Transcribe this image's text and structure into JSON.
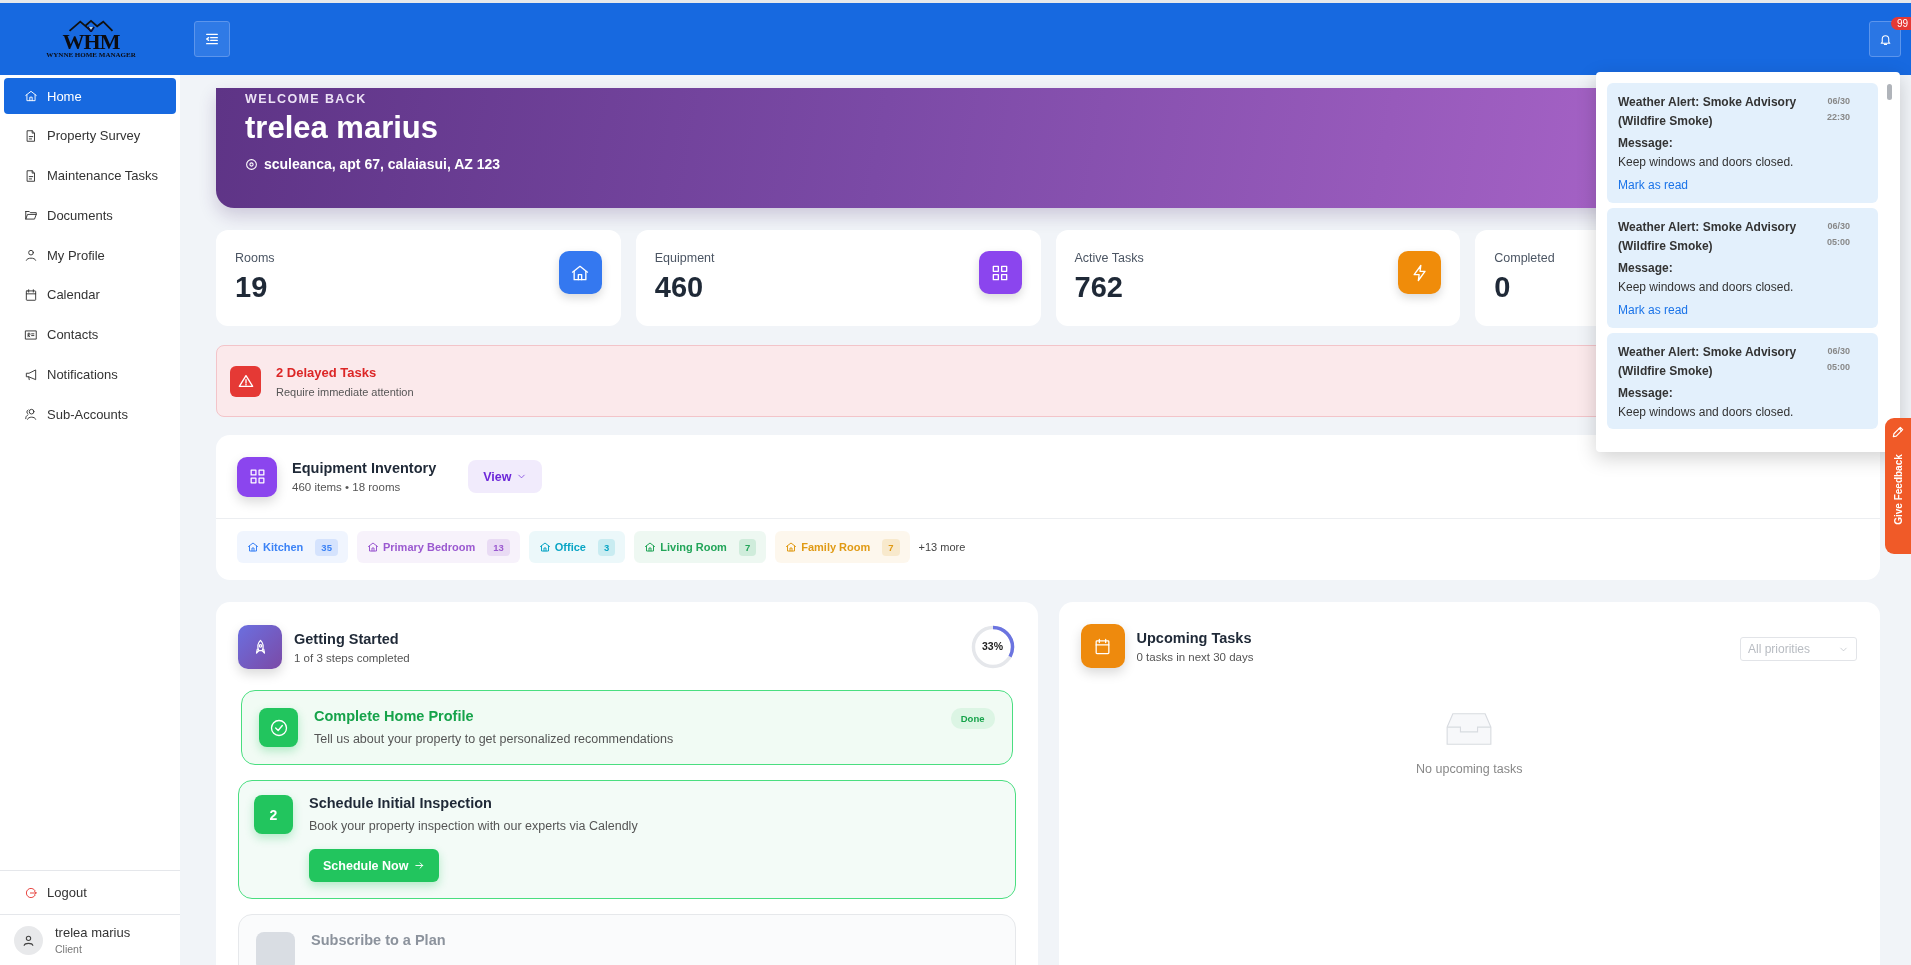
{
  "header": {
    "logo": {
      "mark": "WHM",
      "tagline": "WYNNE HOME MANAGER"
    },
    "notification_badge": "99"
  },
  "sidebar": {
    "items": [
      {
        "label": "Home",
        "selected": true
      },
      {
        "label": "Property Survey",
        "selected": false
      },
      {
        "label": "Maintenance Tasks",
        "selected": false
      },
      {
        "label": "Documents",
        "selected": false
      },
      {
        "label": "My Profile",
        "selected": false
      },
      {
        "label": "Calendar",
        "selected": false
      },
      {
        "label": "Contacts",
        "selected": false
      },
      {
        "label": "Notifications",
        "selected": false
      },
      {
        "label": "Sub-Accounts",
        "selected": false
      }
    ],
    "logout": "Logout",
    "user": {
      "name": "trelea marius",
      "role": "Client"
    }
  },
  "welcome": {
    "eyebrow": "WELCOME BACK",
    "name": "trelea marius",
    "address": "sculeanca, apt 67, calaiasui, AZ 123"
  },
  "stats": [
    {
      "label": "Rooms",
      "value": "19",
      "color": "#3478f0"
    },
    {
      "label": "Equipment",
      "value": "460",
      "color": "#8b45ee"
    },
    {
      "label": "Active Tasks",
      "value": "762",
      "color": "#f08c0a"
    },
    {
      "label": "Completed",
      "value": "0"
    }
  ],
  "alert": {
    "title": "2 Delayed Tasks",
    "subtitle": "Require immediate attention"
  },
  "inventory": {
    "title": "Equipment Inventory",
    "subtitle": "460 items • 18 rooms",
    "view_button": "View",
    "rooms": [
      {
        "name": "Kitchen",
        "count": "35",
        "color": "#3b82f6"
      },
      {
        "name": "Primary Bedroom",
        "count": "13",
        "color": "#9b59d0"
      },
      {
        "name": "Office",
        "count": "3",
        "color": "#0aa5c5"
      },
      {
        "name": "Living Room",
        "count": "7",
        "color": "#22a559"
      },
      {
        "name": "Family Room",
        "count": "7",
        "color": "#e09a14"
      }
    ],
    "more": "+13 more"
  },
  "getting_started": {
    "title": "Getting Started",
    "subtitle": "1 of 3 steps completed",
    "progress": "33%",
    "level": 0.33,
    "steps": [
      {
        "kind": "done",
        "title": "Complete Home Profile",
        "description": "Tell us about your property to get personalized recommendations",
        "badge": "Done"
      },
      {
        "kind": "current",
        "number": "2",
        "title": "Schedule Initial Inspection",
        "description": "Book your property inspection with our experts via Calendly",
        "button": "Schedule Now"
      },
      {
        "kind": "locked",
        "title": "Subscribe to a Plan"
      }
    ]
  },
  "upcoming": {
    "title": "Upcoming Tasks",
    "subtitle": "0 tasks in next 30 days",
    "filter_placeholder": "All priorities",
    "empty": "No upcoming tasks"
  },
  "notifications": [
    {
      "title": "Weather Alert: Smoke Advisory (Wildfire Smoke)",
      "date": "06/30",
      "time": "22:30",
      "label": "Message:",
      "message": "Keep windows and doors closed.",
      "action": "Mark as read"
    },
    {
      "title": "Weather Alert: Smoke Advisory (Wildfire Smoke)",
      "date": "06/30",
      "time": "05:00",
      "label": "Message:",
      "message": "Keep windows and doors closed.",
      "action": "Mark as read"
    },
    {
      "title": "Weather Alert: Smoke Advisory (Wildfire Smoke)",
      "date": "06/30",
      "time": "05:00",
      "label": "Message:",
      "message": "Keep windows and doors closed."
    }
  ],
  "feedback": "Give Feedback"
}
